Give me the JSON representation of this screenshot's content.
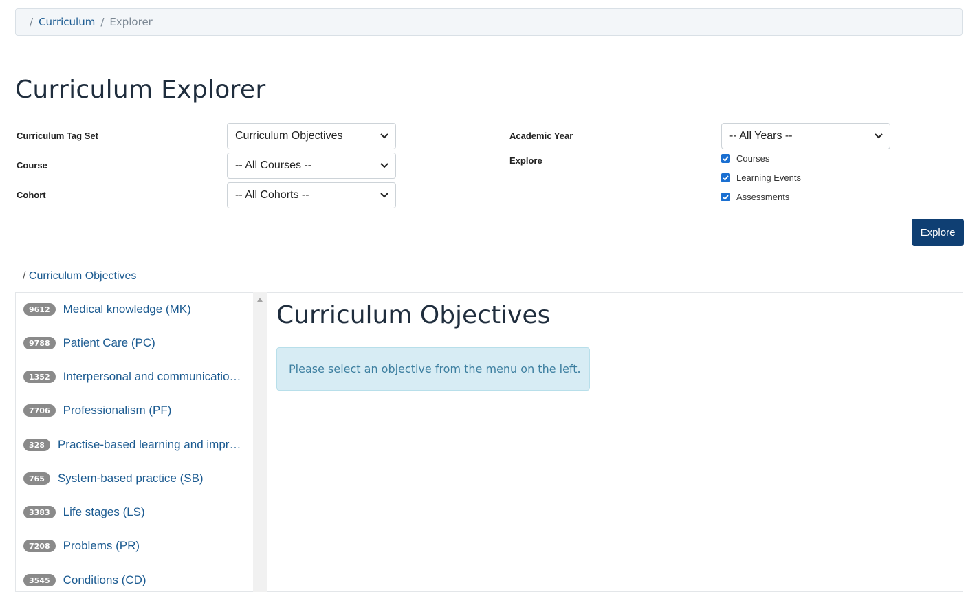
{
  "breadcrumb": {
    "sep": "/",
    "link": "Curriculum",
    "current": "Explorer"
  },
  "page_title": "Curriculum Explorer",
  "form": {
    "tag_set_label": "Curriculum Tag Set",
    "tag_set_value": "Curriculum Objectives",
    "course_label": "Course",
    "course_value": "-- All Courses --",
    "cohort_label": "Cohort",
    "cohort_value": "-- All Cohorts --",
    "year_label": "Academic Year",
    "year_value": "-- All Years --",
    "explore_label": "Explore",
    "checkboxes": [
      {
        "label": "Courses",
        "checked": true
      },
      {
        "label": "Learning Events",
        "checked": true
      },
      {
        "label": "Assessments",
        "checked": true
      }
    ],
    "explore_button": "Explore"
  },
  "path": {
    "slash": "/",
    "link": "Curriculum Objectives"
  },
  "objectives": [
    {
      "count": "9612",
      "label": "Medical knowledge (MK)"
    },
    {
      "count": "9788",
      "label": "Patient Care (PC)"
    },
    {
      "count": "1352",
      "label": "Interpersonal and communication…"
    },
    {
      "count": "7706",
      "label": "Professionalism (PF)"
    },
    {
      "count": "328",
      "label": "Practise-based learning and impro…"
    },
    {
      "count": "765",
      "label": "System-based practice (SB)"
    },
    {
      "count": "3383",
      "label": "Life stages (LS)"
    },
    {
      "count": "7208",
      "label": "Problems (PR)"
    },
    {
      "count": "3545",
      "label": "Conditions (CD)"
    }
  ],
  "main": {
    "title": "Curriculum Objectives",
    "alert": "Please select an objective from the menu on the left."
  },
  "colors": {
    "accent": "#1c5b91",
    "button": "#0f3f73",
    "checkbox": "#1a6fd1",
    "alert_bg": "#d7ecf4"
  }
}
